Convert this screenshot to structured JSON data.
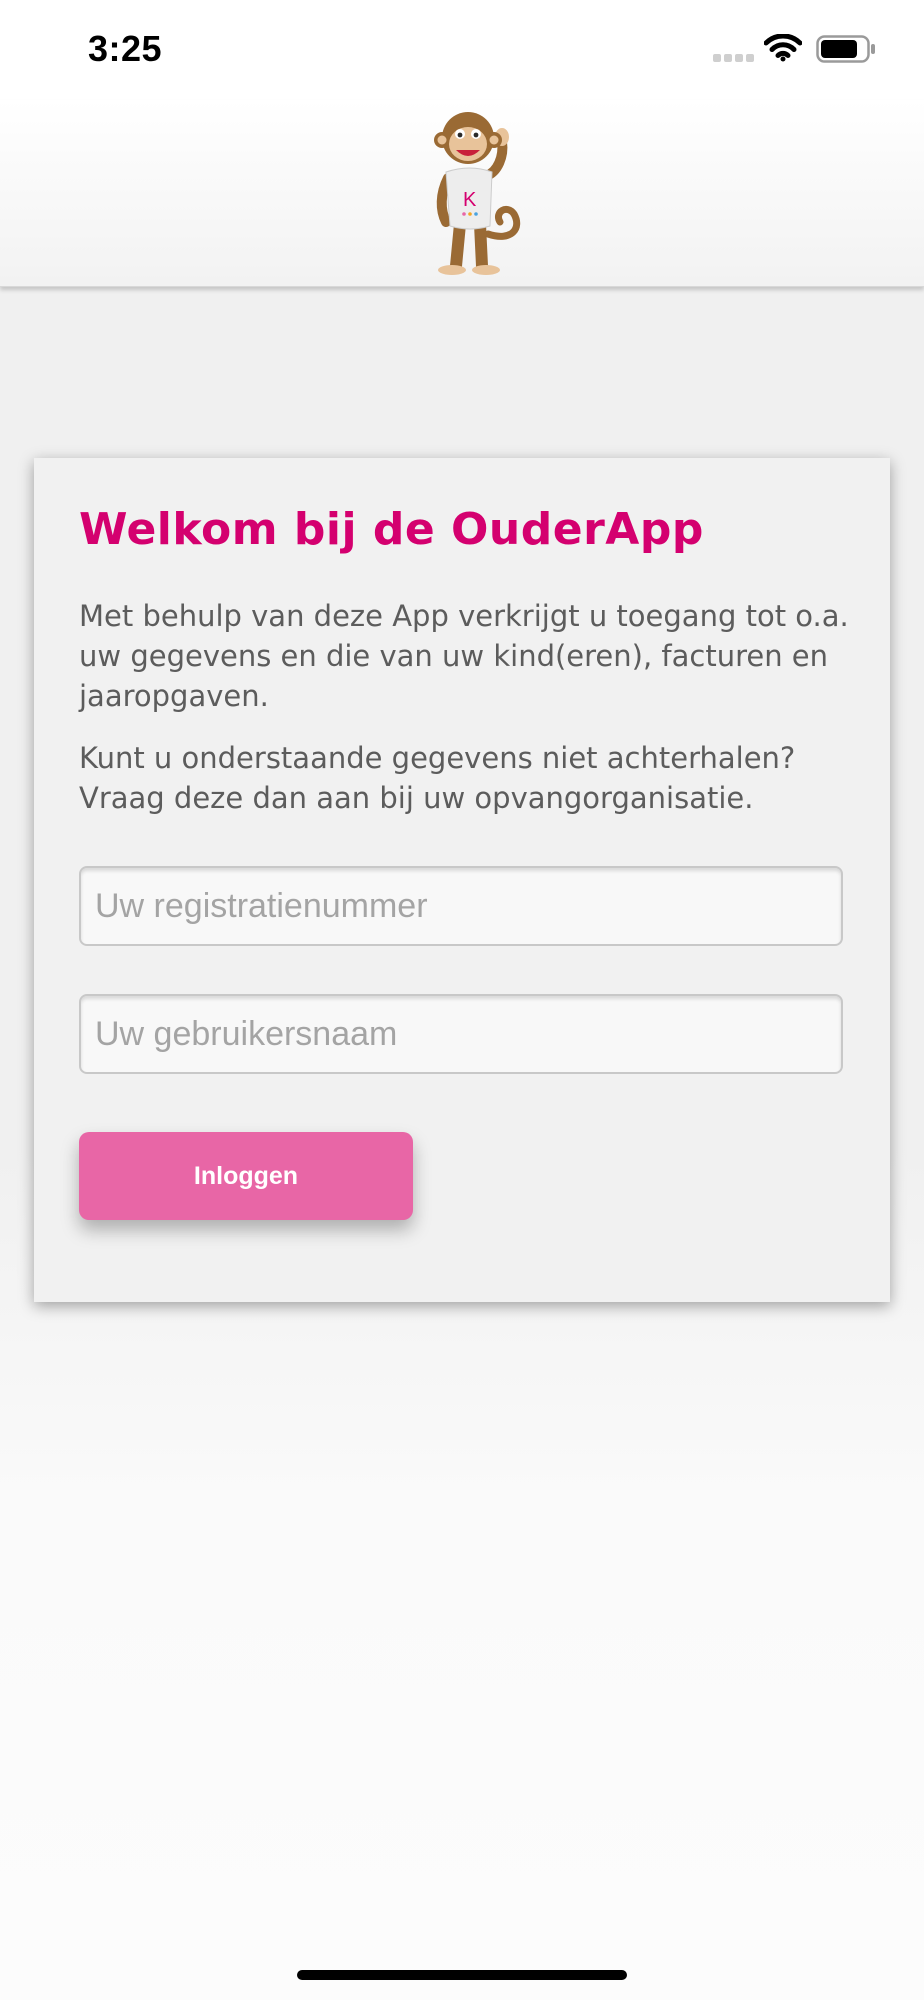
{
  "status_bar": {
    "time": "3:25",
    "icons": [
      "cellular-signal-icon",
      "wifi-icon",
      "battery-icon"
    ]
  },
  "header": {
    "logo": "monkey-mascot-logo",
    "logo_shirt_letter": "K"
  },
  "login_card": {
    "title": "Welkom bij de OuderApp",
    "intro": "Met behulp van deze App verkrijgt u toegang tot o.a. uw gegevens en die van uw kind(eren), facturen en jaaropgaven.",
    "help": "Kunt u onderstaande gegevens niet achterhalen? Vraag deze dan aan bij uw opvangorganisatie.",
    "registration_field": {
      "placeholder": "Uw registratienummer",
      "value": ""
    },
    "username_field": {
      "placeholder": "Uw gebruikersnaam",
      "value": ""
    },
    "login_button": "Inloggen"
  },
  "colors": {
    "accent": "#d4006f",
    "button": "#e866a6",
    "text": "#5c5c5c",
    "background": "#f0f0f0"
  }
}
